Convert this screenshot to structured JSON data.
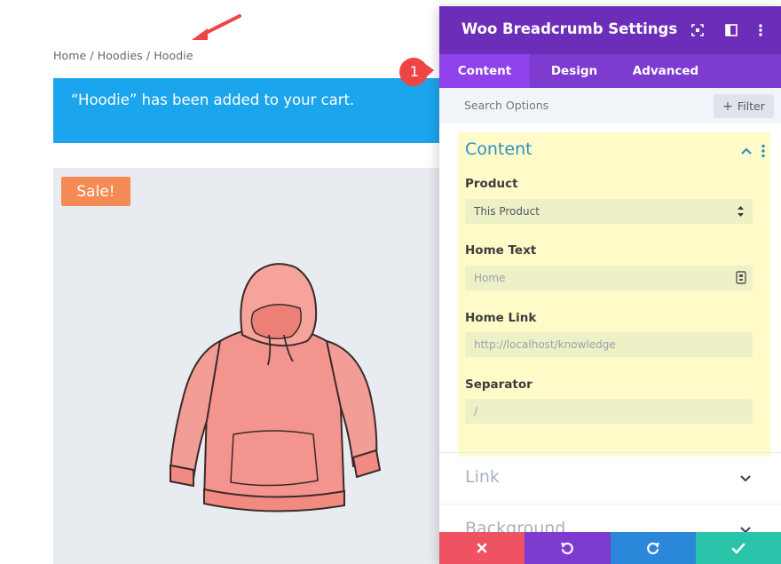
{
  "page": {
    "breadcrumb": "Home / Hoodies / Hoodie",
    "cart_notice": "“Hoodie” has been added to your cart.",
    "sale_badge": "Sale!"
  },
  "panel": {
    "title": "Woo Breadcrumb Settings",
    "tabs": [
      {
        "label": "Content",
        "active": true
      },
      {
        "label": "Design",
        "active": false
      },
      {
        "label": "Advanced",
        "active": false
      }
    ],
    "search_placeholder": "Search Options",
    "filter_label": "Filter",
    "section_title": "Content",
    "fields": {
      "product": {
        "label": "Product",
        "value": "This Product"
      },
      "home_text": {
        "label": "Home Text",
        "placeholder": "Home"
      },
      "home_link": {
        "label": "Home Link",
        "placeholder": "http://localhost/knowledge"
      },
      "separator": {
        "label": "Separator",
        "placeholder": "/"
      }
    },
    "collapsed_sections": [
      "Link",
      "Background"
    ],
    "footer_buttons": [
      "cancel-icon",
      "undo-icon",
      "redo-icon",
      "save-check-icon"
    ]
  },
  "annotation": {
    "step": "1"
  },
  "colors": {
    "header": "#6c2eb9",
    "tabs": "#7d3bcf",
    "active_tab": "#8f42ec",
    "notice": "#1ba5ec",
    "sale": "#f58a54",
    "section_bg": "#fffbc9",
    "annotation": "#ef4444"
  }
}
